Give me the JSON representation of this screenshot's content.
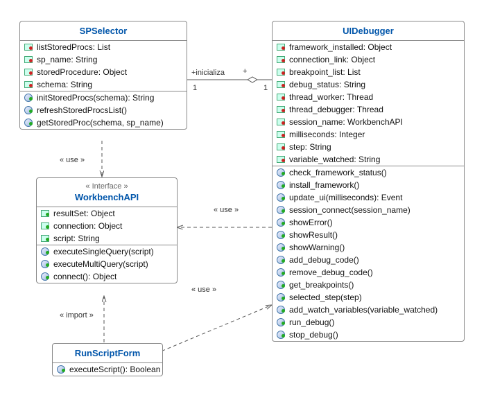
{
  "classes": {
    "SPSelector": {
      "name": "SPSelector",
      "attrs": [
        {
          "vis": "priv",
          "text": "listStoredProcs: List"
        },
        {
          "vis": "priv",
          "text": "sp_name: String"
        },
        {
          "vis": "priv",
          "text": "storedProcedure: Object"
        },
        {
          "vis": "priv",
          "text": "schema: String"
        }
      ],
      "ops": [
        {
          "vis": "pub",
          "text": "initStoredProcs(schema): String"
        },
        {
          "vis": "pub",
          "text": "refreshStoredProcsList()"
        },
        {
          "vis": "pub",
          "text": "getStoredProc(schema, sp_name)"
        }
      ]
    },
    "UIDebugger": {
      "name": "UIDebugger",
      "attrs": [
        {
          "vis": "priv",
          "text": "framework_installed: Object"
        },
        {
          "vis": "priv",
          "text": "connection_link: Object"
        },
        {
          "vis": "priv",
          "text": "breakpoint_list: List"
        },
        {
          "vis": "priv",
          "text": "debug_status: String"
        },
        {
          "vis": "priv",
          "text": "thread_worker: Thread"
        },
        {
          "vis": "priv",
          "text": "thread_debugger: Thread"
        },
        {
          "vis": "priv",
          "text": "session_name: WorkbenchAPI"
        },
        {
          "vis": "priv",
          "text": "milliseconds: Integer"
        },
        {
          "vis": "priv",
          "text": "step: String"
        },
        {
          "vis": "priv",
          "text": "variable_watched: String"
        }
      ],
      "ops": [
        {
          "vis": "pub",
          "text": "check_framework_status()"
        },
        {
          "vis": "pub",
          "text": "install_framework()"
        },
        {
          "vis": "pub",
          "text": "update_ui(milliseconds): Event"
        },
        {
          "vis": "pub",
          "text": "session_connect(session_name)"
        },
        {
          "vis": "pub",
          "text": "showError()"
        },
        {
          "vis": "pub",
          "text": "showResult()"
        },
        {
          "vis": "pub",
          "text": "showWarning()"
        },
        {
          "vis": "pub",
          "text": "add_debug_code()"
        },
        {
          "vis": "pub",
          "text": "remove_debug_code()"
        },
        {
          "vis": "pub",
          "text": "get_breakpoints()"
        },
        {
          "vis": "pub",
          "text": "selected_step(step)"
        },
        {
          "vis": "pub",
          "text": "add_watch_variables(variable_watched)"
        },
        {
          "vis": "pub",
          "text": "run_debug()"
        },
        {
          "vis": "pub",
          "text": "stop_debug()"
        }
      ]
    },
    "WorkbenchAPI": {
      "name": "WorkbenchAPI",
      "stereotype": "« Interface »",
      "attrs": [
        {
          "vis": "pub",
          "text": "resultSet: Object"
        },
        {
          "vis": "pub",
          "text": "connection: Object"
        },
        {
          "vis": "pub",
          "text": "script: String"
        }
      ],
      "ops": [
        {
          "vis": "pub",
          "text": "executeSingleQuery(script)"
        },
        {
          "vis": "pub",
          "text": "executeMultiQuery(script)"
        },
        {
          "vis": "pub",
          "text": "connect(): Object"
        }
      ]
    },
    "RunScriptForm": {
      "name": "RunScriptForm",
      "attrs": [],
      "ops": [
        {
          "vis": "pub",
          "text": "executeScript(): Boolean"
        }
      ]
    }
  },
  "labels": {
    "inicializa": "+inicializa",
    "plus": "+",
    "one1": "1",
    "one2": "1",
    "use1": "« use »",
    "use2": "« use »",
    "use3": "« use »",
    "import": "« import »"
  },
  "chart_data": {
    "type": "table",
    "description": "UML class diagram",
    "classes": [
      {
        "name": "SPSelector",
        "attributes": [
          "listStoredProcs: List",
          "sp_name: String",
          "storedProcedure: Object",
          "schema: String"
        ],
        "operations": [
          "initStoredProcs(schema): String",
          "refreshStoredProcsList()",
          "getStoredProc(schema, sp_name)"
        ]
      },
      {
        "name": "UIDebugger",
        "attributes": [
          "framework_installed: Object",
          "connection_link: Object",
          "breakpoint_list: List",
          "debug_status: String",
          "thread_worker: Thread",
          "thread_debugger: Thread",
          "session_name: WorkbenchAPI",
          "milliseconds: Integer",
          "step: String",
          "variable_watched: String"
        ],
        "operations": [
          "check_framework_status()",
          "install_framework()",
          "update_ui(milliseconds): Event",
          "session_connect(session_name)",
          "showError()",
          "showResult()",
          "showWarning()",
          "add_debug_code()",
          "remove_debug_code()",
          "get_breakpoints()",
          "selected_step(step)",
          "add_watch_variables(variable_watched)",
          "run_debug()",
          "stop_debug()"
        ]
      },
      {
        "name": "WorkbenchAPI",
        "stereotype": "Interface",
        "attributes": [
          "resultSet: Object",
          "connection: Object",
          "script: String"
        ],
        "operations": [
          "executeSingleQuery(script)",
          "executeMultiQuery(script)",
          "connect(): Object"
        ]
      },
      {
        "name": "RunScriptForm",
        "operations": [
          "executeScript(): Boolean"
        ]
      }
    ],
    "relationships": [
      {
        "from": "SPSelector",
        "to": "UIDebugger",
        "type": "association",
        "label": "+inicializa",
        "multiplicity": [
          "1",
          "1"
        ],
        "aggregation": "shared"
      },
      {
        "from": "SPSelector",
        "to": "WorkbenchAPI",
        "type": "dependency",
        "stereotype": "use"
      },
      {
        "from": "UIDebugger",
        "to": "WorkbenchAPI",
        "type": "dependency",
        "stereotype": "use"
      },
      {
        "from": "RunScriptForm",
        "to": "WorkbenchAPI",
        "type": "dependency",
        "stereotype": "import"
      },
      {
        "from": "RunScriptForm",
        "to": "UIDebugger",
        "type": "dependency",
        "stereotype": "use"
      }
    ]
  }
}
